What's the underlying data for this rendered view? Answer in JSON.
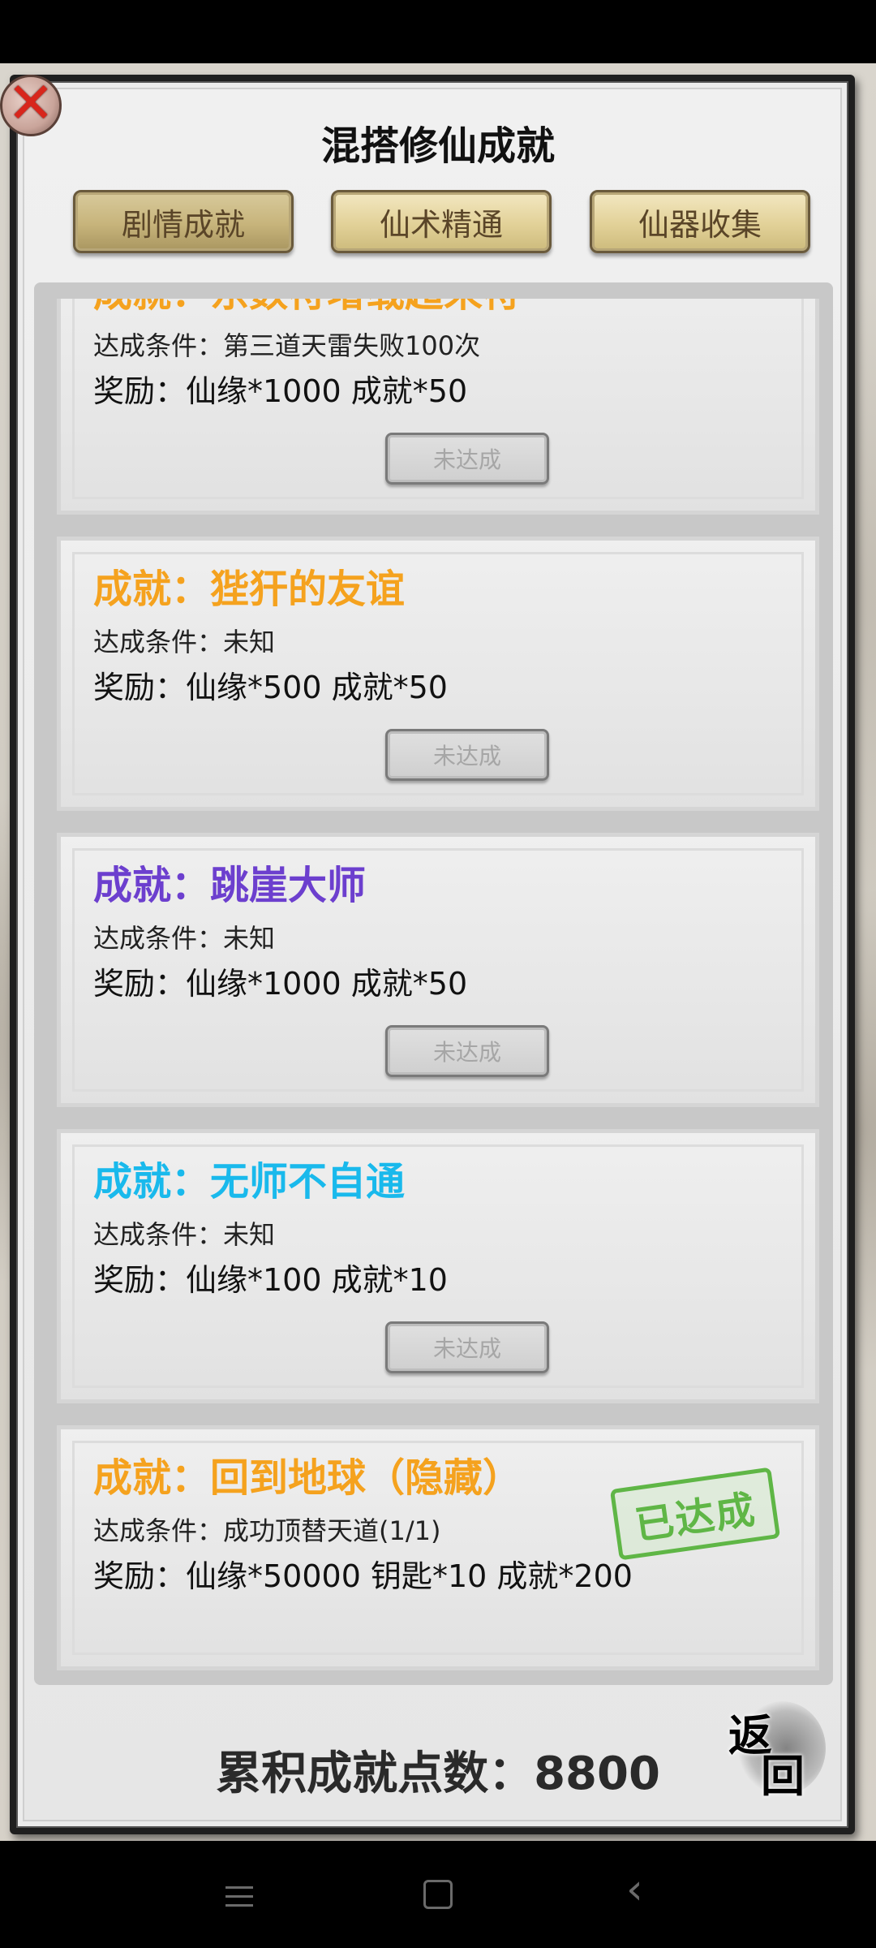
{
  "title": "混搭修仙成就",
  "tabs": [
    {
      "label": "剧情成就"
    },
    {
      "label": "仙术精通"
    },
    {
      "label": "仙器收集"
    }
  ],
  "achievements": [
    {
      "title": "成就：东数符增载超来符",
      "title_color": "#f5a21e",
      "condition": "达成条件：第三道天雷失败100次",
      "reward": "奖励：仙缘*1000 成就*50",
      "button": "未达成"
    },
    {
      "title": "成就：狴犴的友谊",
      "title_color": "#f5a21e",
      "condition": "达成条件：未知",
      "reward": "奖励：仙缘*500 成就*50",
      "button": "未达成"
    },
    {
      "title": "成就：跳崖大师",
      "title_color": "#6c3fce",
      "condition": "达成条件：未知",
      "reward": "奖励：仙缘*1000 成就*50",
      "button": "未达成"
    },
    {
      "title": "成就：无师不自通",
      "title_color": "#19b9ec",
      "condition": "达成条件：未知",
      "reward": "奖励：仙缘*100 成就*10",
      "button": "未达成"
    },
    {
      "title": "成就：回到地球（隐藏）",
      "title_color": "#f5a21e",
      "condition": "达成条件：成功顶替天道(1/1)",
      "reward": "奖励：仙缘*50000 钥匙*10 成就*200",
      "stamp": "已达成"
    }
  ],
  "total": "累积成就点数：8800",
  "back": {
    "char1": "返",
    "char2": "回"
  },
  "close_glyph": "✕",
  "nav_back_glyph": "‹"
}
